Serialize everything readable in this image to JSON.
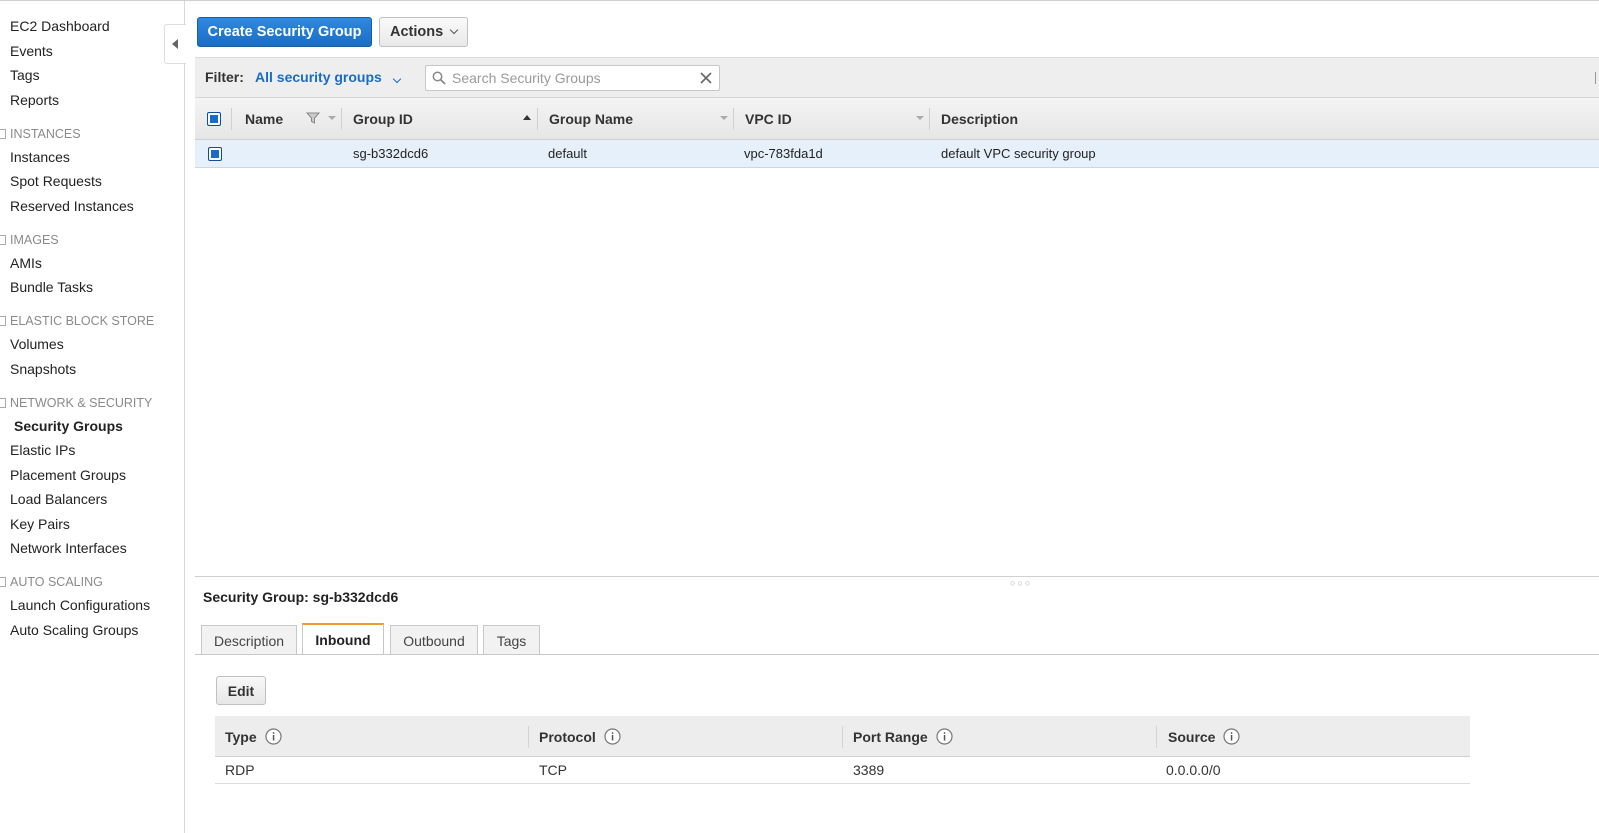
{
  "sidebar": {
    "top_items": [
      "EC2 Dashboard",
      "Events",
      "Tags",
      "Reports"
    ],
    "sections": [
      {
        "title": "INSTANCES",
        "items": [
          "Instances",
          "Spot Requests",
          "Reserved Instances"
        ]
      },
      {
        "title": "IMAGES",
        "items": [
          "AMIs",
          "Bundle Tasks"
        ]
      },
      {
        "title": "ELASTIC BLOCK STORE",
        "items": [
          "Volumes",
          "Snapshots"
        ]
      },
      {
        "title": "NETWORK & SECURITY",
        "items": [
          "Security Groups",
          "Elastic IPs",
          "Placement Groups",
          "Load Balancers",
          "Key Pairs",
          "Network Interfaces"
        ]
      },
      {
        "title": "AUTO SCALING",
        "items": [
          "Launch Configurations",
          "Auto Scaling Groups"
        ]
      }
    ],
    "active_item": "Security Groups"
  },
  "toolbar": {
    "create_label": "Create Security Group",
    "actions_label": "Actions"
  },
  "filter": {
    "label": "Filter:",
    "selected": "All security groups",
    "search_placeholder": "Search Security Groups",
    "search_value": ""
  },
  "grid": {
    "columns": [
      "Name",
      "Group ID",
      "Group Name",
      "VPC ID",
      "Description"
    ],
    "sorted_column": "Group ID",
    "rows": [
      {
        "name": "",
        "group_id": "sg-b332dcd6",
        "group_name": "default",
        "vpc_id": "vpc-783fda1d",
        "description": "default VPC security group",
        "selected": true
      }
    ]
  },
  "details": {
    "title": "Security Group: sg-b332dcd6",
    "tabs": [
      "Description",
      "Inbound",
      "Outbound",
      "Tags"
    ],
    "active_tab": "Inbound",
    "edit_label": "Edit",
    "rules": {
      "columns": [
        "Type",
        "Protocol",
        "Port Range",
        "Source"
      ],
      "rows": [
        {
          "type": "RDP",
          "protocol": "TCP",
          "port_range": "3389",
          "source": "0.0.0.0/0"
        }
      ]
    }
  },
  "colors": {
    "primary_button": "#1a6cc4",
    "active_tab_accent": "#ec9a29",
    "selected_row": "#e6f0fb"
  },
  "icons": [
    "collapse-sidebar-icon",
    "chevron-down-icon",
    "search-icon",
    "clear-icon",
    "funnel-icon",
    "info-icon"
  ]
}
